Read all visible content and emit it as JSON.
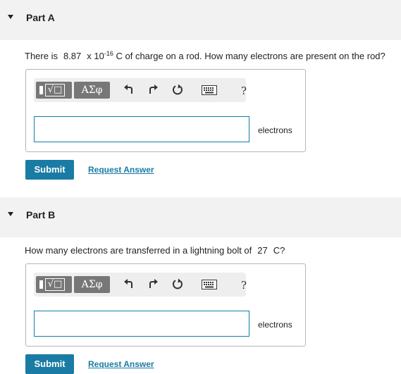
{
  "parts": [
    {
      "title": "Part A",
      "question": {
        "prefix": "There is",
        "value": "8.87",
        "mult": "x 10",
        "exponent": "-16",
        "suffix": "C of charge on a rod. How many electrons are present on the rod?"
      },
      "toolbar": {
        "templates_label": "√□",
        "symbols_label": "ΑΣφ",
        "help_label": "?"
      },
      "answer": {
        "value": "",
        "units": "electrons"
      },
      "submit_label": "Submit",
      "request_label": "Request Answer"
    },
    {
      "title": "Part B",
      "question": {
        "prefix": "How many electrons are transferred in a lightning bolt of",
        "value": "27",
        "suffix": "C?"
      },
      "toolbar": {
        "templates_label": "√□",
        "symbols_label": "ΑΣφ",
        "help_label": "?"
      },
      "answer": {
        "value": "",
        "units": "electrons"
      },
      "submit_label": "Submit",
      "request_label": "Request Answer"
    }
  ],
  "colors": {
    "header_bg": "#f2f2f2",
    "accent": "#1a7ba4",
    "toolbar_btn": "#777777",
    "input_border": "#0f7ea6"
  },
  "icons": [
    "caret-down-icon",
    "undo-icon",
    "redo-icon",
    "reset-icon",
    "keyboard-icon",
    "help-icon"
  ]
}
